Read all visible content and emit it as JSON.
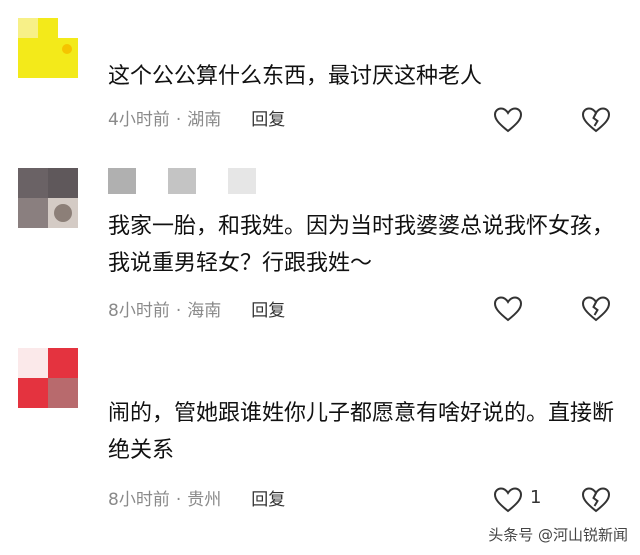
{
  "comments": [
    {
      "text": "这个公公算什么东西，最讨厌这种老人",
      "time": "4小时前",
      "location": "湖南",
      "reply_label": "回复",
      "like_count": ""
    },
    {
      "text": "我家一胎，和我姓。因为当时我婆婆总说我怀女孩，我说重男轻女？行跟我姓～",
      "time": "8小时前",
      "location": "海南",
      "reply_label": "回复",
      "like_count": ""
    },
    {
      "text": "闹的，管她跟谁姓你儿子都愿意有啥好说的。直接断绝关系",
      "time": "8小时前",
      "location": "贵州",
      "reply_label": "回复",
      "like_count": "1"
    }
  ],
  "watermark": "头条号 @河山锐新闻",
  "icons": {
    "like": "heart-outline-icon",
    "dislike": "broken-heart-icon"
  },
  "colors": {
    "avatar1_main": "#f3ea1a",
    "avatar1_light": "#f7f088",
    "avatar2_dark": "#5f585b",
    "avatar2_mid": "#8a7f7f",
    "avatar2_light": "#d4cbc5",
    "avatar3_red": "#e4333f",
    "avatar3_pink": "#f0a8ad",
    "avatar3_dark": "#b86a6d",
    "meta_gray": "#8a8a8a"
  }
}
